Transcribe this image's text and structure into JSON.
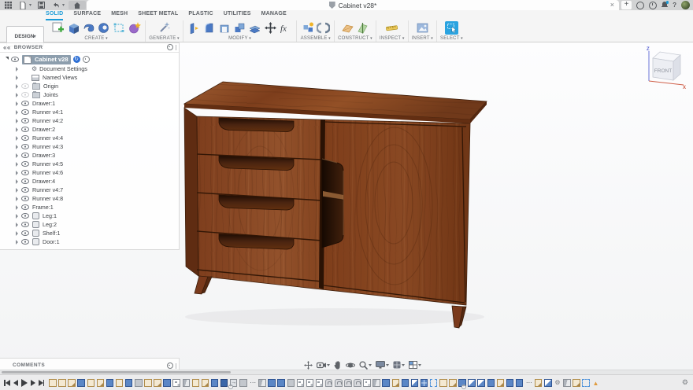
{
  "window": {
    "doc_title": "Cabinet v28*",
    "tab_close": "×",
    "new_tab": "+"
  },
  "quick_access_icons": [
    "data-panel-grid-icon",
    "file-menu-icon",
    "save-icon",
    "undo-icon",
    "redo-icon",
    "home-icon"
  ],
  "account_icons": [
    "extensions-icon",
    "job-status-clock-icon",
    "notifications-bell-icon",
    "help-icon",
    "avatar"
  ],
  "ribbon": {
    "design_label": "DESIGN",
    "tabs": [
      {
        "label": "SOLID",
        "active": true
      },
      {
        "label": "SURFACE",
        "active": false
      },
      {
        "label": "MESH",
        "active": false
      },
      {
        "label": "SHEET METAL",
        "active": false
      },
      {
        "label": "PLASTIC",
        "active": false
      },
      {
        "label": "UTILITIES",
        "active": false
      },
      {
        "label": "MANAGE",
        "active": false
      }
    ],
    "groups": [
      {
        "label": "CREATE"
      },
      {
        "label": "GENERATE"
      },
      {
        "label": "MODIFY"
      },
      {
        "label": "ASSEMBLE"
      },
      {
        "label": "CONSTRUCT"
      },
      {
        "label": "INSPECT"
      },
      {
        "label": "INSERT"
      },
      {
        "label": "SELECT"
      }
    ]
  },
  "browser": {
    "header": "BROWSER",
    "items": [
      {
        "label": "Cabinet v28",
        "icon": "assembly",
        "eye": "normal",
        "root": true,
        "selected": true
      },
      {
        "label": "Document Settings",
        "icon": "gear",
        "eye": "none"
      },
      {
        "label": "Named Views",
        "icon": "views",
        "eye": "none"
      },
      {
        "label": "Origin",
        "icon": "folder",
        "eye": "dim"
      },
      {
        "label": "Joints",
        "icon": "folder",
        "eye": "dim"
      },
      {
        "label": "Drawer:1",
        "icon": "component",
        "eye": "normal"
      },
      {
        "label": "Runner v4:1",
        "icon": "component",
        "eye": "normal"
      },
      {
        "label": "Runner v4:2",
        "icon": "component",
        "eye": "normal"
      },
      {
        "label": "Drawer:2",
        "icon": "component",
        "eye": "normal"
      },
      {
        "label": "Runner v4:4",
        "icon": "component",
        "eye": "normal"
      },
      {
        "label": "Runner v4:3",
        "icon": "component",
        "eye": "normal"
      },
      {
        "label": "Drawer:3",
        "icon": "component",
        "eye": "normal"
      },
      {
        "label": "Runner v4:5",
        "icon": "component",
        "eye": "normal"
      },
      {
        "label": "Runner v4:6",
        "icon": "component",
        "eye": "normal"
      },
      {
        "label": "Drawer:4",
        "icon": "component",
        "eye": "normal"
      },
      {
        "label": "Runner v4:7",
        "icon": "component",
        "eye": "normal"
      },
      {
        "label": "Runner v4:8",
        "icon": "component",
        "eye": "normal"
      },
      {
        "label": "Frame:1",
        "icon": "component",
        "eye": "normal"
      },
      {
        "label": "Leg:1",
        "icon": "body",
        "eye": "normal"
      },
      {
        "label": "Leg:2",
        "icon": "body",
        "eye": "normal"
      },
      {
        "label": "Shelf:1",
        "icon": "body",
        "eye": "normal"
      },
      {
        "label": "Door:1",
        "icon": "body",
        "eye": "normal"
      }
    ]
  },
  "comments": {
    "header": "COMMENTS"
  },
  "viewcube": {
    "front_label": "FRONT",
    "axis_z": "Z",
    "axis_x": "X"
  },
  "nav_bar_icons": [
    "fit-icon",
    "look-at-icon",
    "pan-hand-icon",
    "orbit-icon",
    "zoom-icon",
    "display-settings-icon",
    "grid-snaps-icon",
    "viewports-icon"
  ],
  "timeline": {
    "features": [
      "sketch",
      "sketch",
      "sketch-f",
      "extrude",
      "sketch",
      "sketch-f",
      "extrude",
      "sketch",
      "extrude",
      "box",
      "sketch",
      "sketch-f",
      "extrude",
      "pattern",
      "mirror",
      "sketch",
      "sketch-f",
      "extrude",
      "combine",
      "link",
      "box",
      "dots",
      "mirror",
      "extrude",
      "extrude",
      "box",
      "pattern",
      "pattern",
      "pattern",
      "joint",
      "joint",
      "joint",
      "joint",
      "pattern",
      "mirror",
      "extrude",
      "sketch-f",
      "extrude",
      "quarter",
      "grid",
      "select",
      "sketch",
      "sketch-f",
      "extrude",
      "quarter",
      "quarter",
      "extrude",
      "sketch-f",
      "extrude",
      "extrude",
      "dots",
      "sketch-f",
      "quarter",
      "gear",
      "mirror",
      "sketch-f",
      "select",
      "warn"
    ]
  },
  "colors": {
    "accent_blue": "#1a9bd7",
    "selection_gray_blue": "#8d9ead",
    "wood_base": "#8a4523",
    "wood_dark_seam": "#331706",
    "canvas_bg": "#f6f7f8",
    "titlebar_bg": "#d2d3d4"
  }
}
